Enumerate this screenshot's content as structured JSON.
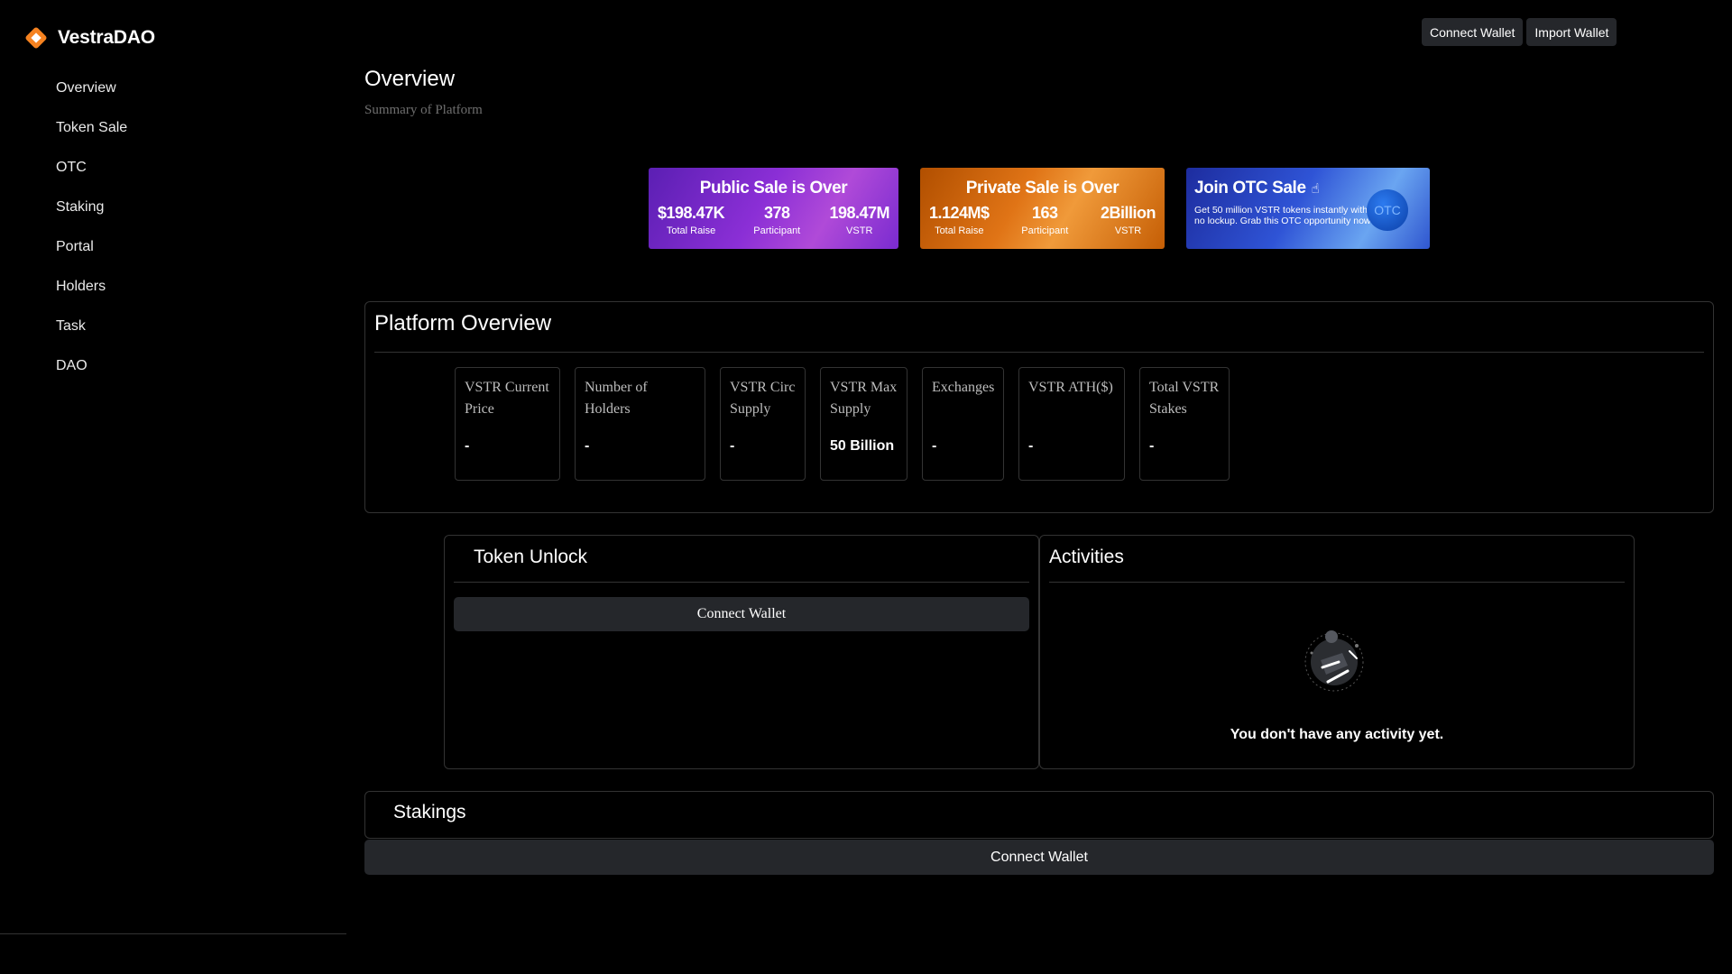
{
  "brand": {
    "name": "VestraDAO",
    "logo_icon": "diamond-logo-icon",
    "accent": "#f58220"
  },
  "nav": [
    {
      "label": "Overview"
    },
    {
      "label": "Token Sale"
    },
    {
      "label": "OTC"
    },
    {
      "label": "Staking"
    },
    {
      "label": "Portal"
    },
    {
      "label": "Holders"
    },
    {
      "label": "Task"
    },
    {
      "label": "DAO"
    }
  ],
  "top": {
    "connect_label": "Connect Wallet",
    "import_label": "Import Wallet"
  },
  "header": {
    "title": "Overview",
    "subtitle": "Summary of Platform"
  },
  "banners": {
    "public": {
      "title": "Public Sale is Over",
      "stats": [
        {
          "value": "$198.47K",
          "label": "Total Raise"
        },
        {
          "value": "378",
          "label": "Participant"
        },
        {
          "value": "198.47M",
          "label": "VSTR"
        }
      ]
    },
    "private": {
      "title": "Private Sale is Over",
      "stats": [
        {
          "value": "1.124M$",
          "label": "Total Raise"
        },
        {
          "value": "163",
          "label": "Participant"
        },
        {
          "value": "2Billion",
          "label": "VSTR"
        }
      ]
    },
    "otc": {
      "title": "Join OTC Sale",
      "description": "Get 50 million VSTR tokens instantly with no lockup. Grab this OTC opportunity now!",
      "coin_label": "OTC"
    }
  },
  "platform_overview": {
    "title": "Platform Overview",
    "cards": [
      {
        "label": "VSTR Current Price",
        "value": "-"
      },
      {
        "label": "Number of Holders",
        "value": "-"
      },
      {
        "label": "VSTR Circ Supply",
        "value": "-"
      },
      {
        "label": "VSTR Max Supply",
        "value": "50 Billion"
      },
      {
        "label": "Exchanges",
        "value": "-"
      },
      {
        "label": "VSTR ATH($)",
        "value": "-"
      },
      {
        "label": "Total VSTR Stakes",
        "value": "-"
      }
    ]
  },
  "token_unlock": {
    "title": "Token Unlock",
    "connect_label": "Connect Wallet"
  },
  "activities": {
    "title": "Activities",
    "empty_text": "You don't have any activity yet."
  },
  "stakings": {
    "title": "Stakings",
    "connect_label": "Connect Wallet"
  }
}
